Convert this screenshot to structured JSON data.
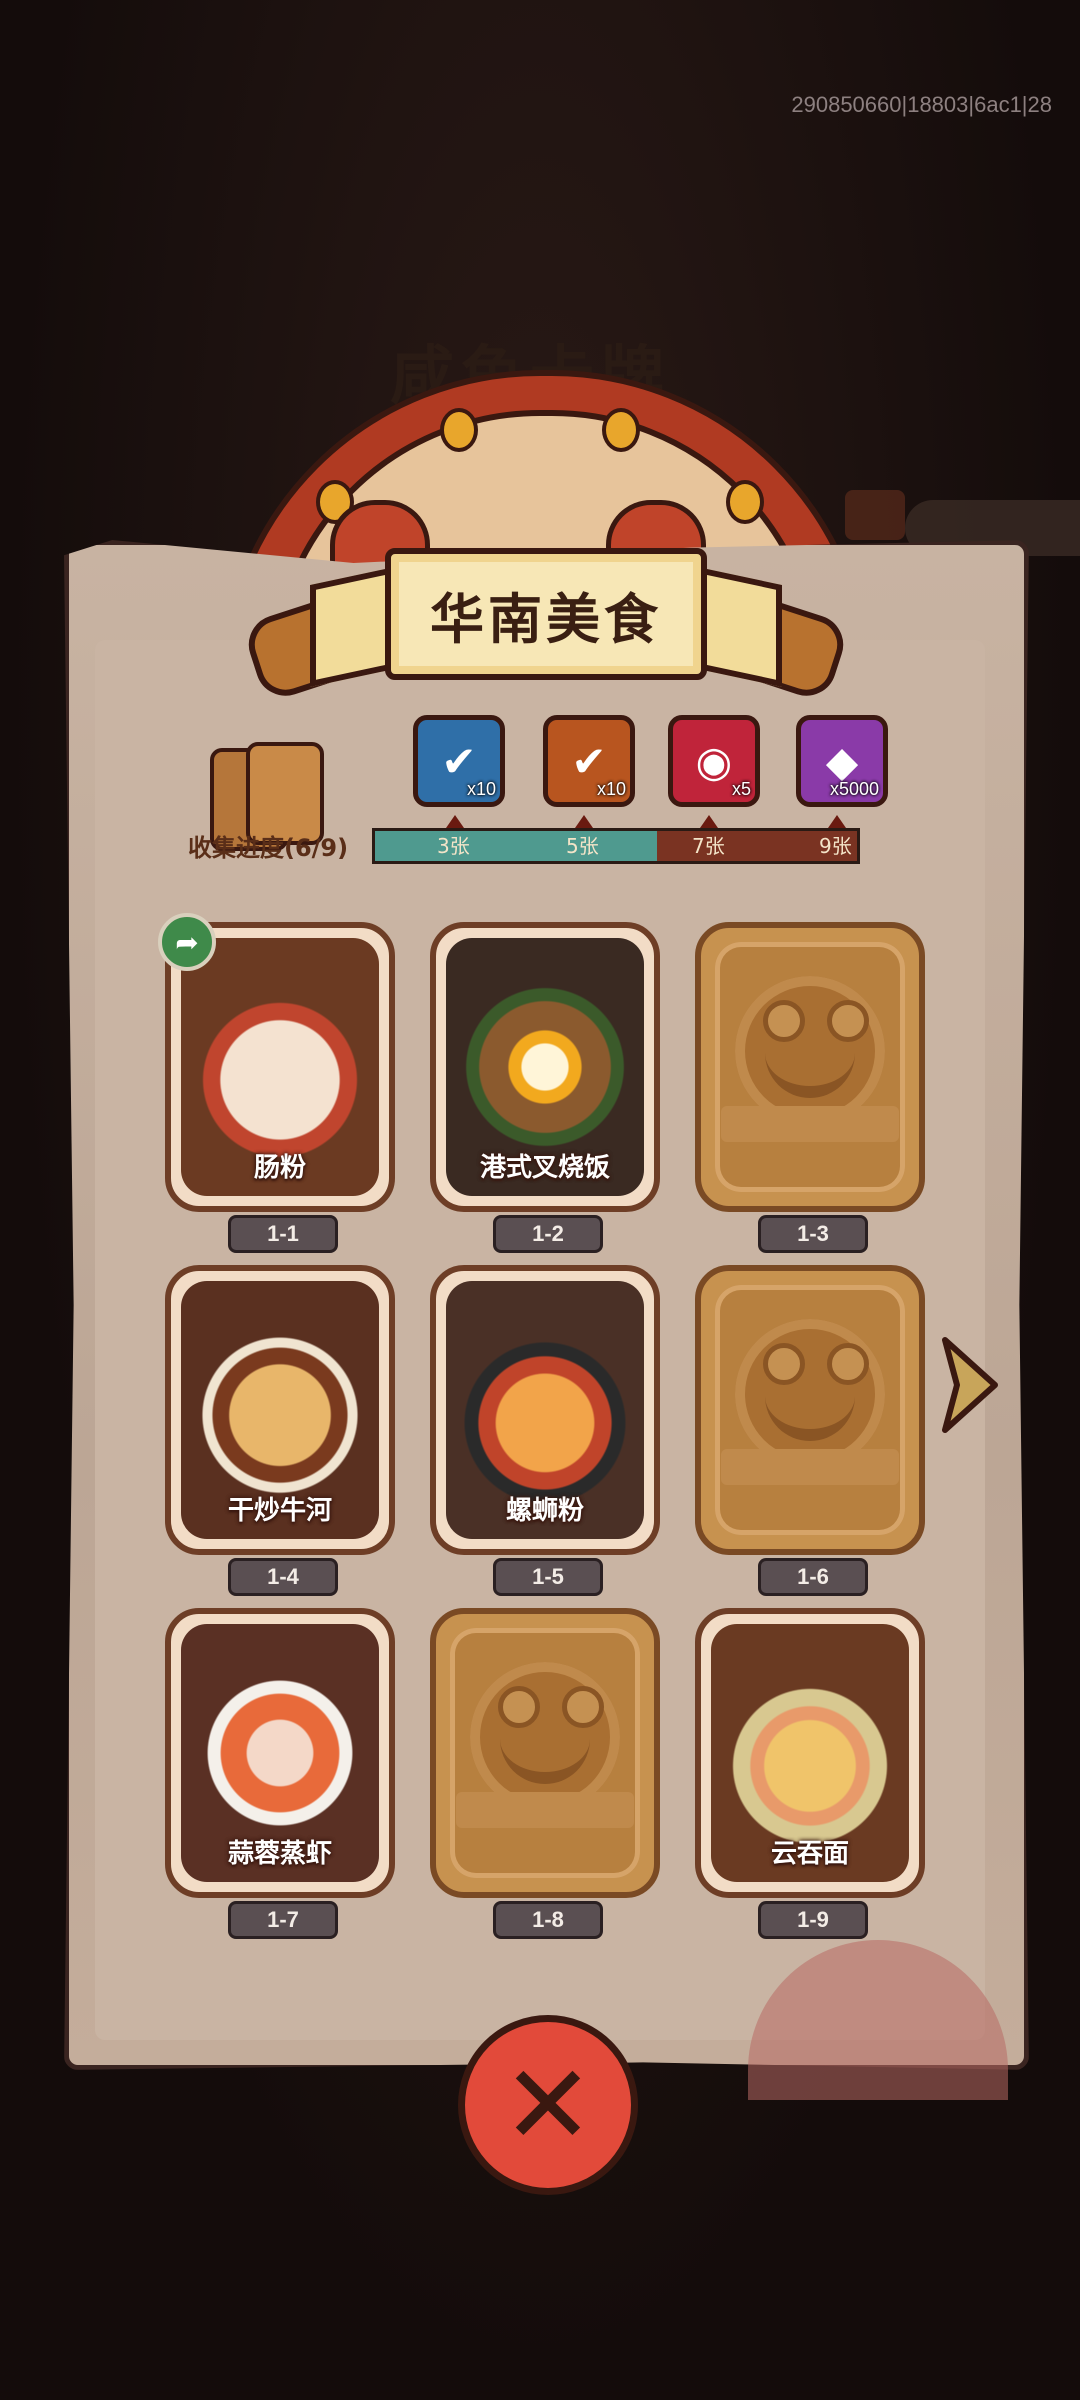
{
  "debug": {
    "id_text": "290850660|18803|6ac1|28"
  },
  "background": {
    "ghost_title": "咸鱼卡牌"
  },
  "header": {
    "title": "华南美食"
  },
  "progress": {
    "label": "收集进度(6/9)",
    "collected": 6,
    "total": 9,
    "bar_fraction": 0.585,
    "milestones": [
      {
        "label": "3张",
        "reward_icon": "treasure-chest-check-icon",
        "reward_count": "x10",
        "color": "#2f6fa8"
      },
      {
        "label": "5张",
        "reward_icon": "scroll-check-icon",
        "reward_count": "x10",
        "color": "#b8551f"
      },
      {
        "label": "7张",
        "reward_icon": "swirl-orb-icon",
        "reward_count": "x5",
        "color": "#c0243a"
      },
      {
        "label": "9张",
        "reward_icon": "crystal-icon",
        "reward_count": "x5000",
        "color": "#8a3aa8"
      }
    ]
  },
  "cards": [
    {
      "num": "1-1",
      "name": "肠粉",
      "unlocked": true
    },
    {
      "num": "1-2",
      "name": "港式叉烧饭",
      "unlocked": true
    },
    {
      "num": "1-3",
      "name": "",
      "unlocked": false
    },
    {
      "num": "1-4",
      "name": "干炒牛河",
      "unlocked": true
    },
    {
      "num": "1-5",
      "name": "螺蛳粉",
      "unlocked": true
    },
    {
      "num": "1-6",
      "name": "",
      "unlocked": false
    },
    {
      "num": "1-7",
      "name": "蒜蓉蒸虾",
      "unlocked": true
    },
    {
      "num": "1-8",
      "name": "",
      "unlocked": false
    },
    {
      "num": "1-9",
      "name": "云吞面",
      "unlocked": true
    }
  ],
  "controls": {
    "share_icon": "share-arrow-icon",
    "next_icon": "next-page-arrow-icon",
    "close_icon": "close-x-icon",
    "close_glyph": "✕"
  }
}
